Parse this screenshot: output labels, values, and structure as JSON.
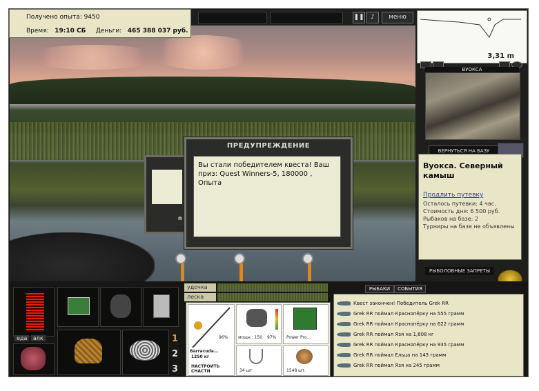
{
  "hud": {
    "experience": "Получено опыта: 9450",
    "time_label": "Время:",
    "time_value": "19:10 СБ",
    "money_label": "Деньги:",
    "money_value": "465 388 037 руб."
  },
  "menu_button": "меню",
  "map": {
    "depth": "3,31 m",
    "location_caption": "ВУОКСА"
  },
  "return_button": "ВЕРНУТЬСЯ НА БАЗУ",
  "base": {
    "title": "Вуокса. Северный камыш",
    "extend_link": "Продлить путевку",
    "lines": [
      "Осталось путевки: 4 час.",
      "Стоимость дня: 6 500 руб.",
      "Рыбаков на базе: 2",
      "Турниры на базе не объявлены"
    ]
  },
  "bans_button": "РЫБОЛОВНЫЕ ЗАПРЕТЫ",
  "dialog": {
    "title": "ПРЕДУПРЕЖДЕНИЕ",
    "message": "Вы стали победителем квеста! Ваш приз: Quest Winners-5, 180000 , Опыта",
    "back_letter": "п"
  },
  "inventory": {
    "tab_food": "еда",
    "tab_alk": "алк",
    "slots": [
      "1",
      "2",
      "3"
    ]
  },
  "rod_panel": {
    "rod_label": "удочка",
    "line_label": "леска",
    "rod_name": "Barracuda...",
    "rod_weight": "1250 кг",
    "rod_percent": "96%",
    "setup": "НАСТРОИТЬ СНАСТИ",
    "reel_label": "мощн.: 150",
    "reel_percent": "97%",
    "line_name": "Power Pro...",
    "hooks_count": "34 шт.",
    "bait_count": "1548 шт."
  },
  "feed": {
    "tab_fishers": "РЫБАКИ",
    "tab_events": "СОБЫТИЯ",
    "rows": [
      "Квест закончен! Победитель Grek RR",
      "Grek RR поймал Краснопёрку на 555 грамм",
      "Grek RR поймал Краснопёрку на 622 грамм",
      "Grek RR поймал Язя на 1,608 кг",
      "Grek RR поймал Краснопёрку на 935 грамм",
      "Grek RR поймал Ельца на 143 грамм",
      "Grek RR поймал Язя на 245 грамм"
    ]
  }
}
